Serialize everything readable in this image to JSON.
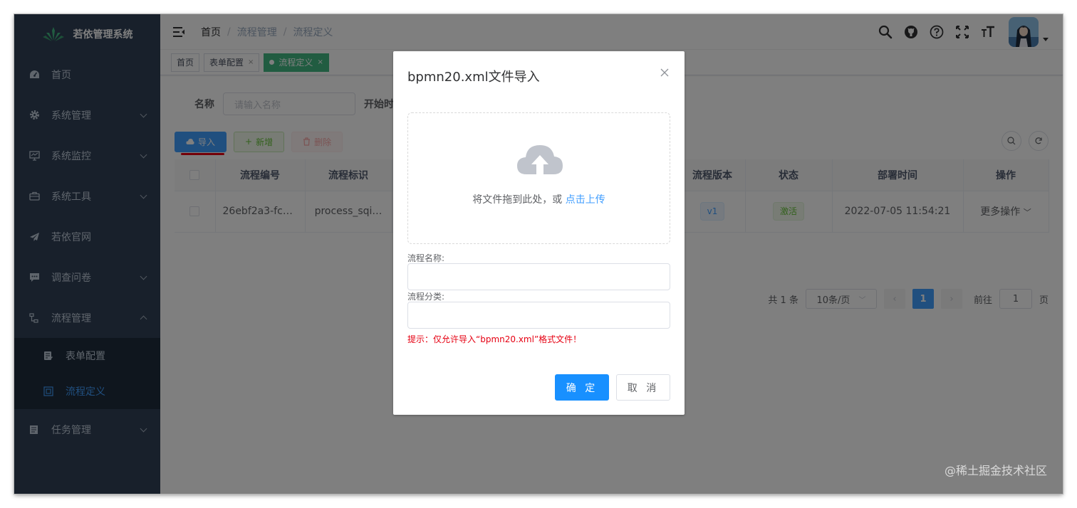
{
  "app": {
    "title": "若依管理系统"
  },
  "sidebar": {
    "items": [
      {
        "label": "首页",
        "icon": "dashboard-icon"
      },
      {
        "label": "系统管理",
        "icon": "gear-icon"
      },
      {
        "label": "系统监控",
        "icon": "monitor-icon"
      },
      {
        "label": "系统工具",
        "icon": "toolbox-icon"
      },
      {
        "label": "若依官网",
        "icon": "paper-plane-icon"
      },
      {
        "label": "调查问卷",
        "icon": "chat-icon"
      },
      {
        "label": "流程管理",
        "icon": "flow-icon"
      },
      {
        "label": "任务管理",
        "icon": "task-icon"
      }
    ],
    "submenu": [
      {
        "label": "表单配置",
        "icon": "form-icon"
      },
      {
        "label": "流程定义",
        "icon": "definition-icon"
      }
    ]
  },
  "breadcrumb": {
    "home": "首页",
    "parent": "流程管理",
    "current": "流程定义",
    "separator": "/"
  },
  "tags": {
    "home": "首页",
    "form_config": "表单配置",
    "process_def": "流程定义",
    "close": "×"
  },
  "search": {
    "name_label": "名称",
    "name_placeholder": "请输入名称",
    "start_label": "开始时"
  },
  "toolbar": {
    "import": "导入",
    "add": "新增",
    "delete": "删除"
  },
  "table": {
    "headers": {
      "code": "流程编号",
      "key": "流程标识",
      "version": "流程版本",
      "status": "状态",
      "deploy_time": "部署时间",
      "action": "操作"
    },
    "rows": [
      {
        "code": "26ebf2a3-fc1…",
        "key": "process_sqi…",
        "version": "v1",
        "status": "激活",
        "deploy_time": "2022-07-05 11:54:21",
        "action": "更多操作"
      }
    ]
  },
  "pagination": {
    "total": "共 1 条",
    "page_size": "10条/页",
    "current_page": "1",
    "goto_label": "前往",
    "goto_value": "1",
    "page_unit": "页"
  },
  "dialog": {
    "title": "bpmn20.xml文件导入",
    "drop_text": "将文件拖到此处，或",
    "drop_link": "点击上传",
    "name_label": "流程名称:",
    "category_label": "流程分类:",
    "tip": "提示：仅允许导入“bpmn20.xml”格式文件！",
    "confirm": "确 定",
    "cancel": "取 消"
  },
  "watermark": "@稀土掘金技术社区",
  "colors": {
    "sidebar_bg": "#304156",
    "primary": "#409eff",
    "success": "#67c23a",
    "danger": "#e60012",
    "tag_active": "#42b983"
  }
}
